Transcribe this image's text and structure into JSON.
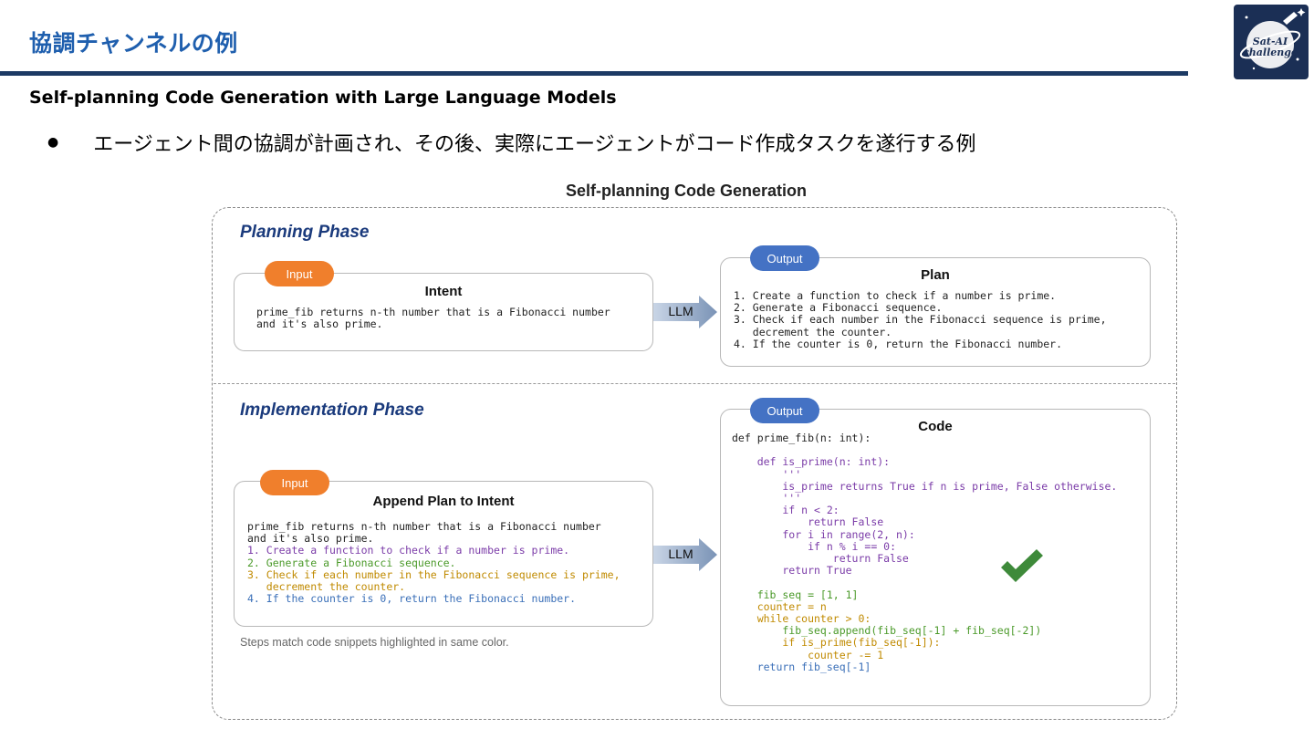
{
  "slide": {
    "title": "協調チャンネルの例",
    "subtitle": "Self-planning Code Generation with Large Language Models",
    "bullet": "エージェント間の協調が計画され、その後、実際にエージェントがコード作成タスクを遂行する例"
  },
  "figure": {
    "title": "Self-planning Code Generation",
    "planning": {
      "phase_title": "Planning Phase",
      "input_pill": "Input",
      "intent_title": "Intent",
      "intent_text": "prime_fib returns n-th number that is a Fibonacci number\nand it's also prime.",
      "llm_label": "LLM",
      "output_pill": "Output",
      "plan_title": "Plan",
      "plan_text": "1. Create a function to check if a number is prime.\n2. Generate a Fibonacci sequence.\n3. Check if each number in the Fibonacci sequence is prime,\n   decrement the counter.\n4. If the counter is 0, return the Fibonacci number."
    },
    "implementation": {
      "phase_title": "Implementation Phase",
      "input_pill": "Input",
      "append_title": "Append Plan to Intent",
      "intent_text": "prime_fib returns n-th number that is a Fibonacci number\nand it's also prime.",
      "step1": "1. Create a function to check if a number is prime.",
      "step2": "2. Generate a Fibonacci sequence.",
      "step3": "3. Check if each number in the Fibonacci sequence is prime,\n   decrement the counter.",
      "step4": "4. If the counter is 0, return the Fibonacci number.",
      "llm_label": "LLM",
      "output_pill": "Output",
      "code_title": "Code",
      "code_def": "def prime_fib(n: int):",
      "code_isprime": "    def is_prime(n: int):\n        '''\n        is_prime returns True if n is prime, False otherwise.\n        '''\n        if n < 2:\n            return False\n        for i in range(2, n):\n            if n % i == 0:\n                return False\n        return True",
      "code_fib": "    fib_seq = [1, 1]",
      "code_counter": "    counter = n\n    while counter > 0:",
      "code_append": "        fib_seq.append(fib_seq[-1] + fib_seq[-2])",
      "code_check": "        if is_prime(fib_seq[-1]):\n            counter -= 1",
      "code_return": "    return fib_seq[-1]",
      "caption": "Steps match code snippets highlighted in same color."
    },
    "colors": {
      "step1": "#7b3ca8",
      "step2": "#4b9a2a",
      "step3": "#c08a00",
      "step4": "#3a6fb8",
      "input_pill": "#f07f2c",
      "output_pill": "#4472c4",
      "check": "#3e8a3a"
    },
    "icons": [
      "check-mark-icon",
      "arrow-right-icon"
    ]
  }
}
